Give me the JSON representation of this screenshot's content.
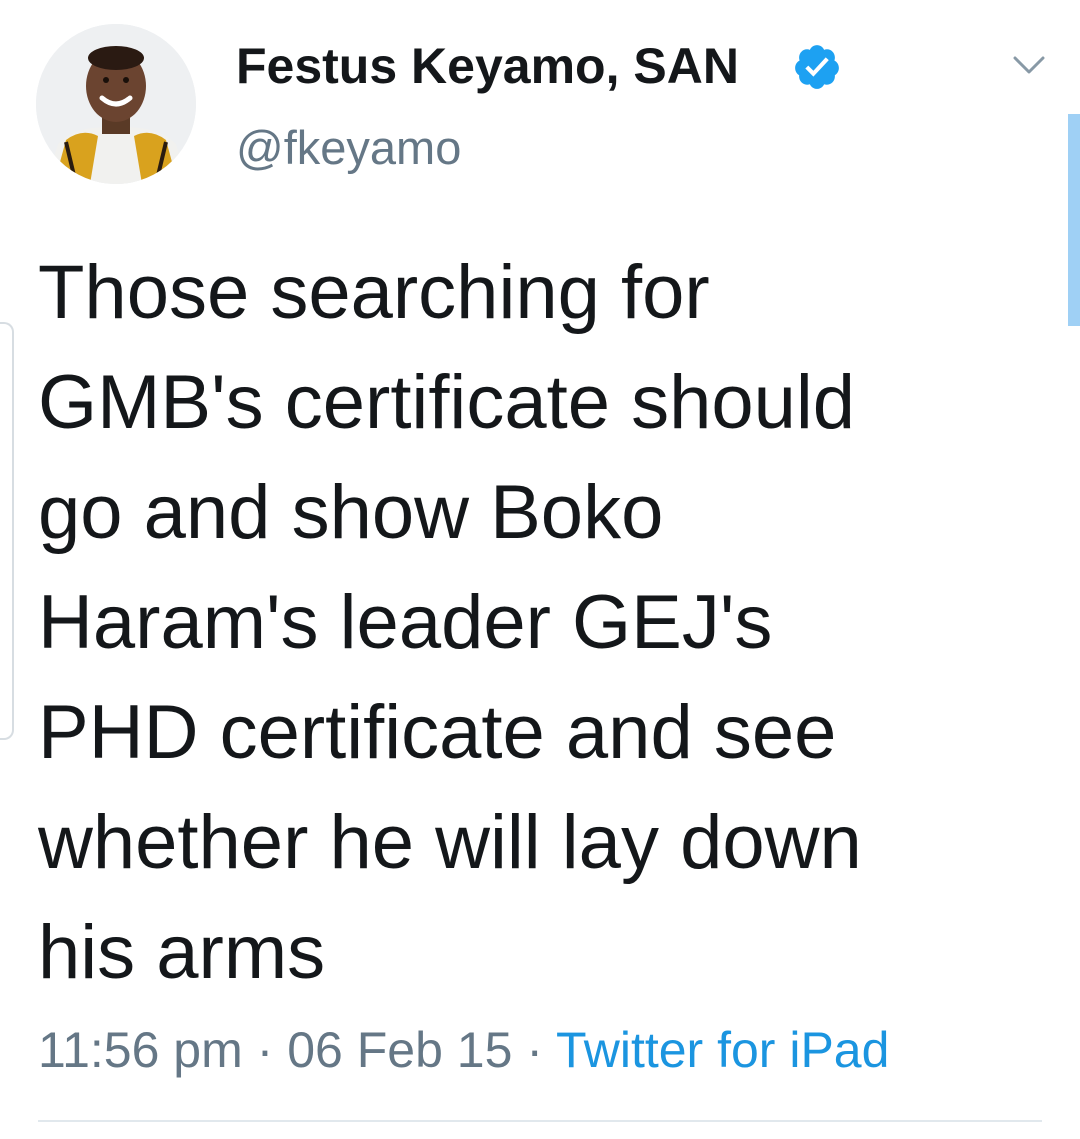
{
  "author": {
    "display_name": "Festus Keyamo, SAN",
    "handle": "@fkeyamo",
    "verified": true,
    "avatar_icon": "profile-photo",
    "verified_icon": "verified-badge-icon",
    "menu_icon": "chevron-down-icon"
  },
  "tweet": {
    "lines": [
      "Those searching for",
      "GMB's certificate should",
      "go and show Boko",
      "Haram's leader GEJ's",
      "PHD certificate and see",
      "whether he will lay down",
      "his arms"
    ]
  },
  "meta": {
    "time": "11:56 pm",
    "separator": "·",
    "date": "06 Feb 15",
    "source": "Twitter for iPad"
  },
  "colors": {
    "text": "#14171a",
    "secondary": "#657786",
    "accent": "#1b95e0",
    "verified": "#1da1f2",
    "divider": "#e1e8ed"
  }
}
